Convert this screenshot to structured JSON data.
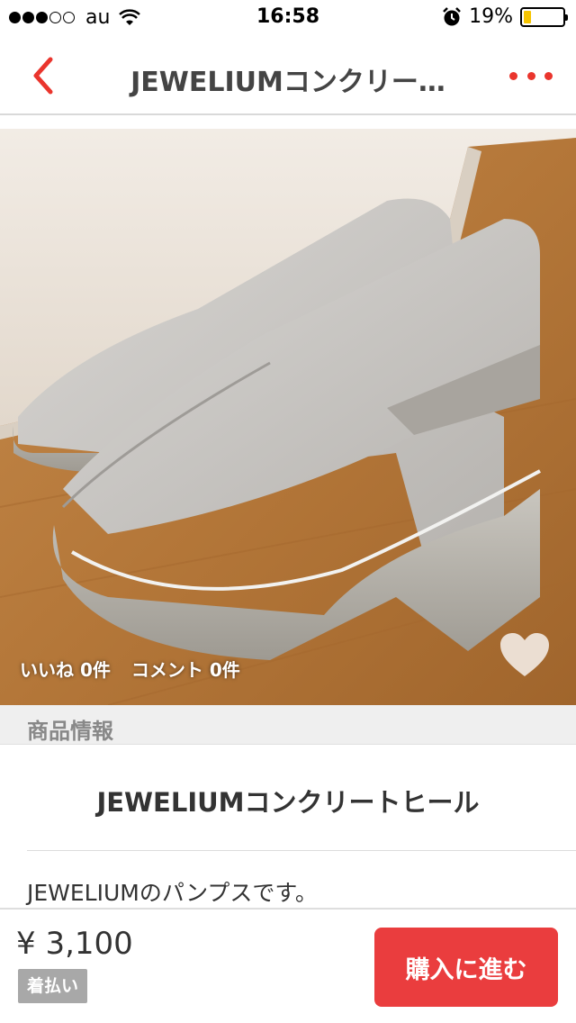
{
  "status_bar": {
    "carrier": "au",
    "time": "16:58",
    "battery_percent": "19%",
    "battery_level": 0.19,
    "signal_strength": 3,
    "signal_max": 5,
    "icons": [
      "signal-dots",
      "wifi-icon",
      "alarm-icon",
      "battery-icon"
    ]
  },
  "nav": {
    "title": "JEWELIUMコンクリー…",
    "back_icon": "chevron-left-icon",
    "more_icon": "more-dots-icon",
    "accent_color": "#ea352d"
  },
  "photo": {
    "likes_text": "いいね 0件",
    "comments_text": "コメント 0件",
    "like_icon": "heart-icon"
  },
  "section": {
    "header": "商品情報"
  },
  "item": {
    "title": "JEWELIUMコンクリートヒール",
    "description": "JEWELIUMのパンプスです。"
  },
  "purchase": {
    "price": "¥ 3,100",
    "shipping": "着払い",
    "buy_label": "購入に進む",
    "button_color": "#ea3d3e"
  }
}
